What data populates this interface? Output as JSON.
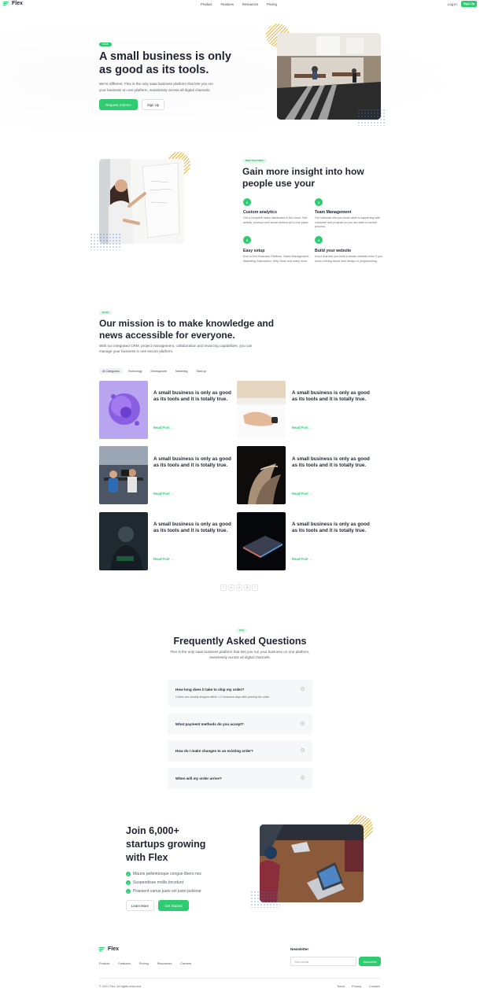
{
  "brand": {
    "name": "Flex",
    "accent": "#2ecc71"
  },
  "nav": {
    "links": [
      "Product",
      "Features",
      "Resources",
      "Pricing"
    ],
    "login": "Log In",
    "signup": "Sign Up"
  },
  "hero": {
    "badge": "SAAS",
    "title_l1": "A small business is only",
    "title_l2": "as good as its tools.",
    "text_l1": "We're different. Flex is the only saas business platform that lets you run",
    "text_l2": "your business on one platform, seamlessly across all digital channels.",
    "cta_primary": "Request a Demo",
    "cta_secondary": "Sign Up"
  },
  "insight": {
    "badge": "NEW FEATURES",
    "title_l1": "Gain more insight into how",
    "title_l2": "people use your",
    "features": [
      {
        "num": "1",
        "title": "Custom analytics",
        "text": "Get a complete sales dashboard in the cloud. See activity, revenue and social metrics all in one place."
      },
      {
        "num": "2",
        "title": "Team Management",
        "text": "Our calendar lets you know what is happening with customer and projects so you are able to control process."
      },
      {
        "num": "3",
        "title": "Easy setup",
        "text": "End to End Business Platform, Sales Management, Marketing Automation, Help Desk and many more"
      },
      {
        "num": "4",
        "title": "Build your website",
        "text": "A tool that lets you build a dream website even if you know nothing about web design or programming."
      }
    ]
  },
  "mission": {
    "badge": "BLOG",
    "title_l1": "Our mission is to make knowledge and",
    "title_l2": "news accessible for everyone.",
    "text_l1": "With our integrated CRM, project management, collaboration and invoicing capabilities, you can",
    "text_l2": "manage your business in one secure platform.",
    "tabs": [
      "All Categories",
      "Technology",
      "Development",
      "Marketing",
      "Start-up"
    ],
    "posts": [
      {
        "title_l1": "A small business is only as good",
        "title_l2": "as its tools and it is totally true.",
        "link": "Read Post →"
      },
      {
        "title_l1": "A small business is only as good",
        "title_l2": "as its tools and it is totally true.",
        "link": "Read Post →"
      },
      {
        "title_l1": "A small business is only as good",
        "title_l2": "as its tools and it is totally true.",
        "link": "Read Post →"
      },
      {
        "title_l1": "A small business is only as good",
        "title_l2": "as its tools and it is totally true.",
        "link": "Read Post →"
      },
      {
        "title_l1": "A small business is only as good",
        "title_l2": "as its tools and it is totally true.",
        "link": "Read Post →"
      },
      {
        "title_l1": "A small business is only as good",
        "title_l2": "as its tools and it is totally true.",
        "link": "Read Post →"
      }
    ],
    "pager": [
      "‹",
      "1",
      "2",
      "3",
      "›"
    ]
  },
  "faq": {
    "badge": "FAQ",
    "title": "Frequently Asked Questions",
    "text_l1": "Flex is the only saas business platform that lets you run your business on one platform,",
    "text_l2": "seamlessly across all digital channels.",
    "items": [
      {
        "q": "How long does it take to ship my order?",
        "a": "Orders are usually shipped within 1-2 business days after placing the order.",
        "icon": "−"
      },
      {
        "q": "What payment methods do you accept?",
        "icon": "+"
      },
      {
        "q": "How do I make changes to an existing order?",
        "icon": "+"
      },
      {
        "q": "When will my order arrive?",
        "icon": "+"
      }
    ]
  },
  "join": {
    "title_l1": "Join 6,000+",
    "title_l2": "startups growing",
    "title_l3": "with Flex",
    "checks": [
      "Mauris pellentesque congue libero nec",
      "Suspendisse mollis tincidunt",
      "Praesent varius justo vel justo pulvinar"
    ],
    "learn_more": "Learn More",
    "get_started": "Get Started"
  },
  "footer": {
    "links": [
      "Product",
      "Features",
      "Pricing",
      "Resources",
      "Careers"
    ],
    "newsletter_title": "Newsletter",
    "email_placeholder": "Your email",
    "subscribe": "Subscribe",
    "copyright": "© 2021 Flex. All rights reserved.",
    "legal": [
      "Terms",
      "Privacy",
      "Cookies"
    ]
  }
}
